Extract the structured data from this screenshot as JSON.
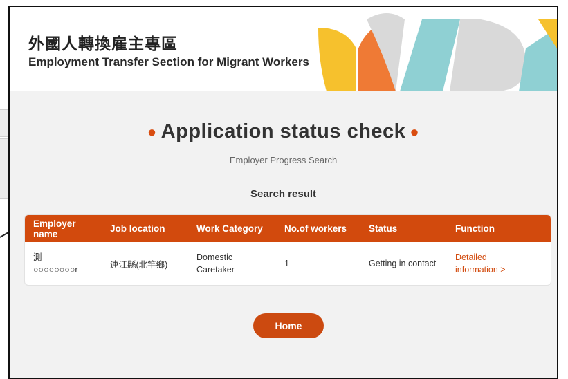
{
  "header": {
    "title_zh": "外國人轉換雇主專區",
    "title_en": "Employment Transfer Section for Migrant Workers"
  },
  "page": {
    "title": "Application status check",
    "subtitle": "Employer Progress Search",
    "result_label": "Search result"
  },
  "table": {
    "headers": [
      "Employer name",
      "Job location",
      "Work Category",
      "No.of workers",
      "Status",
      "Function"
    ],
    "rows": [
      {
        "employer_line1": "測",
        "employer_line2": "○○○○○○○○r",
        "job_location": "連江縣(北竿鄉)",
        "work_category_line1": "Domestic",
        "work_category_line2": "Caretaker",
        "workers": "1",
        "status": "Getting in contact",
        "function_line1": "Detailed",
        "function_line2": "information >"
      }
    ]
  },
  "buttons": {
    "home": "Home"
  },
  "colors": {
    "accent": "#d24a0d",
    "deco_yellow": "#f6c12d",
    "deco_orange": "#ef7a35",
    "deco_teal": "#8fd0d3",
    "deco_gray": "#d9d9d9"
  }
}
